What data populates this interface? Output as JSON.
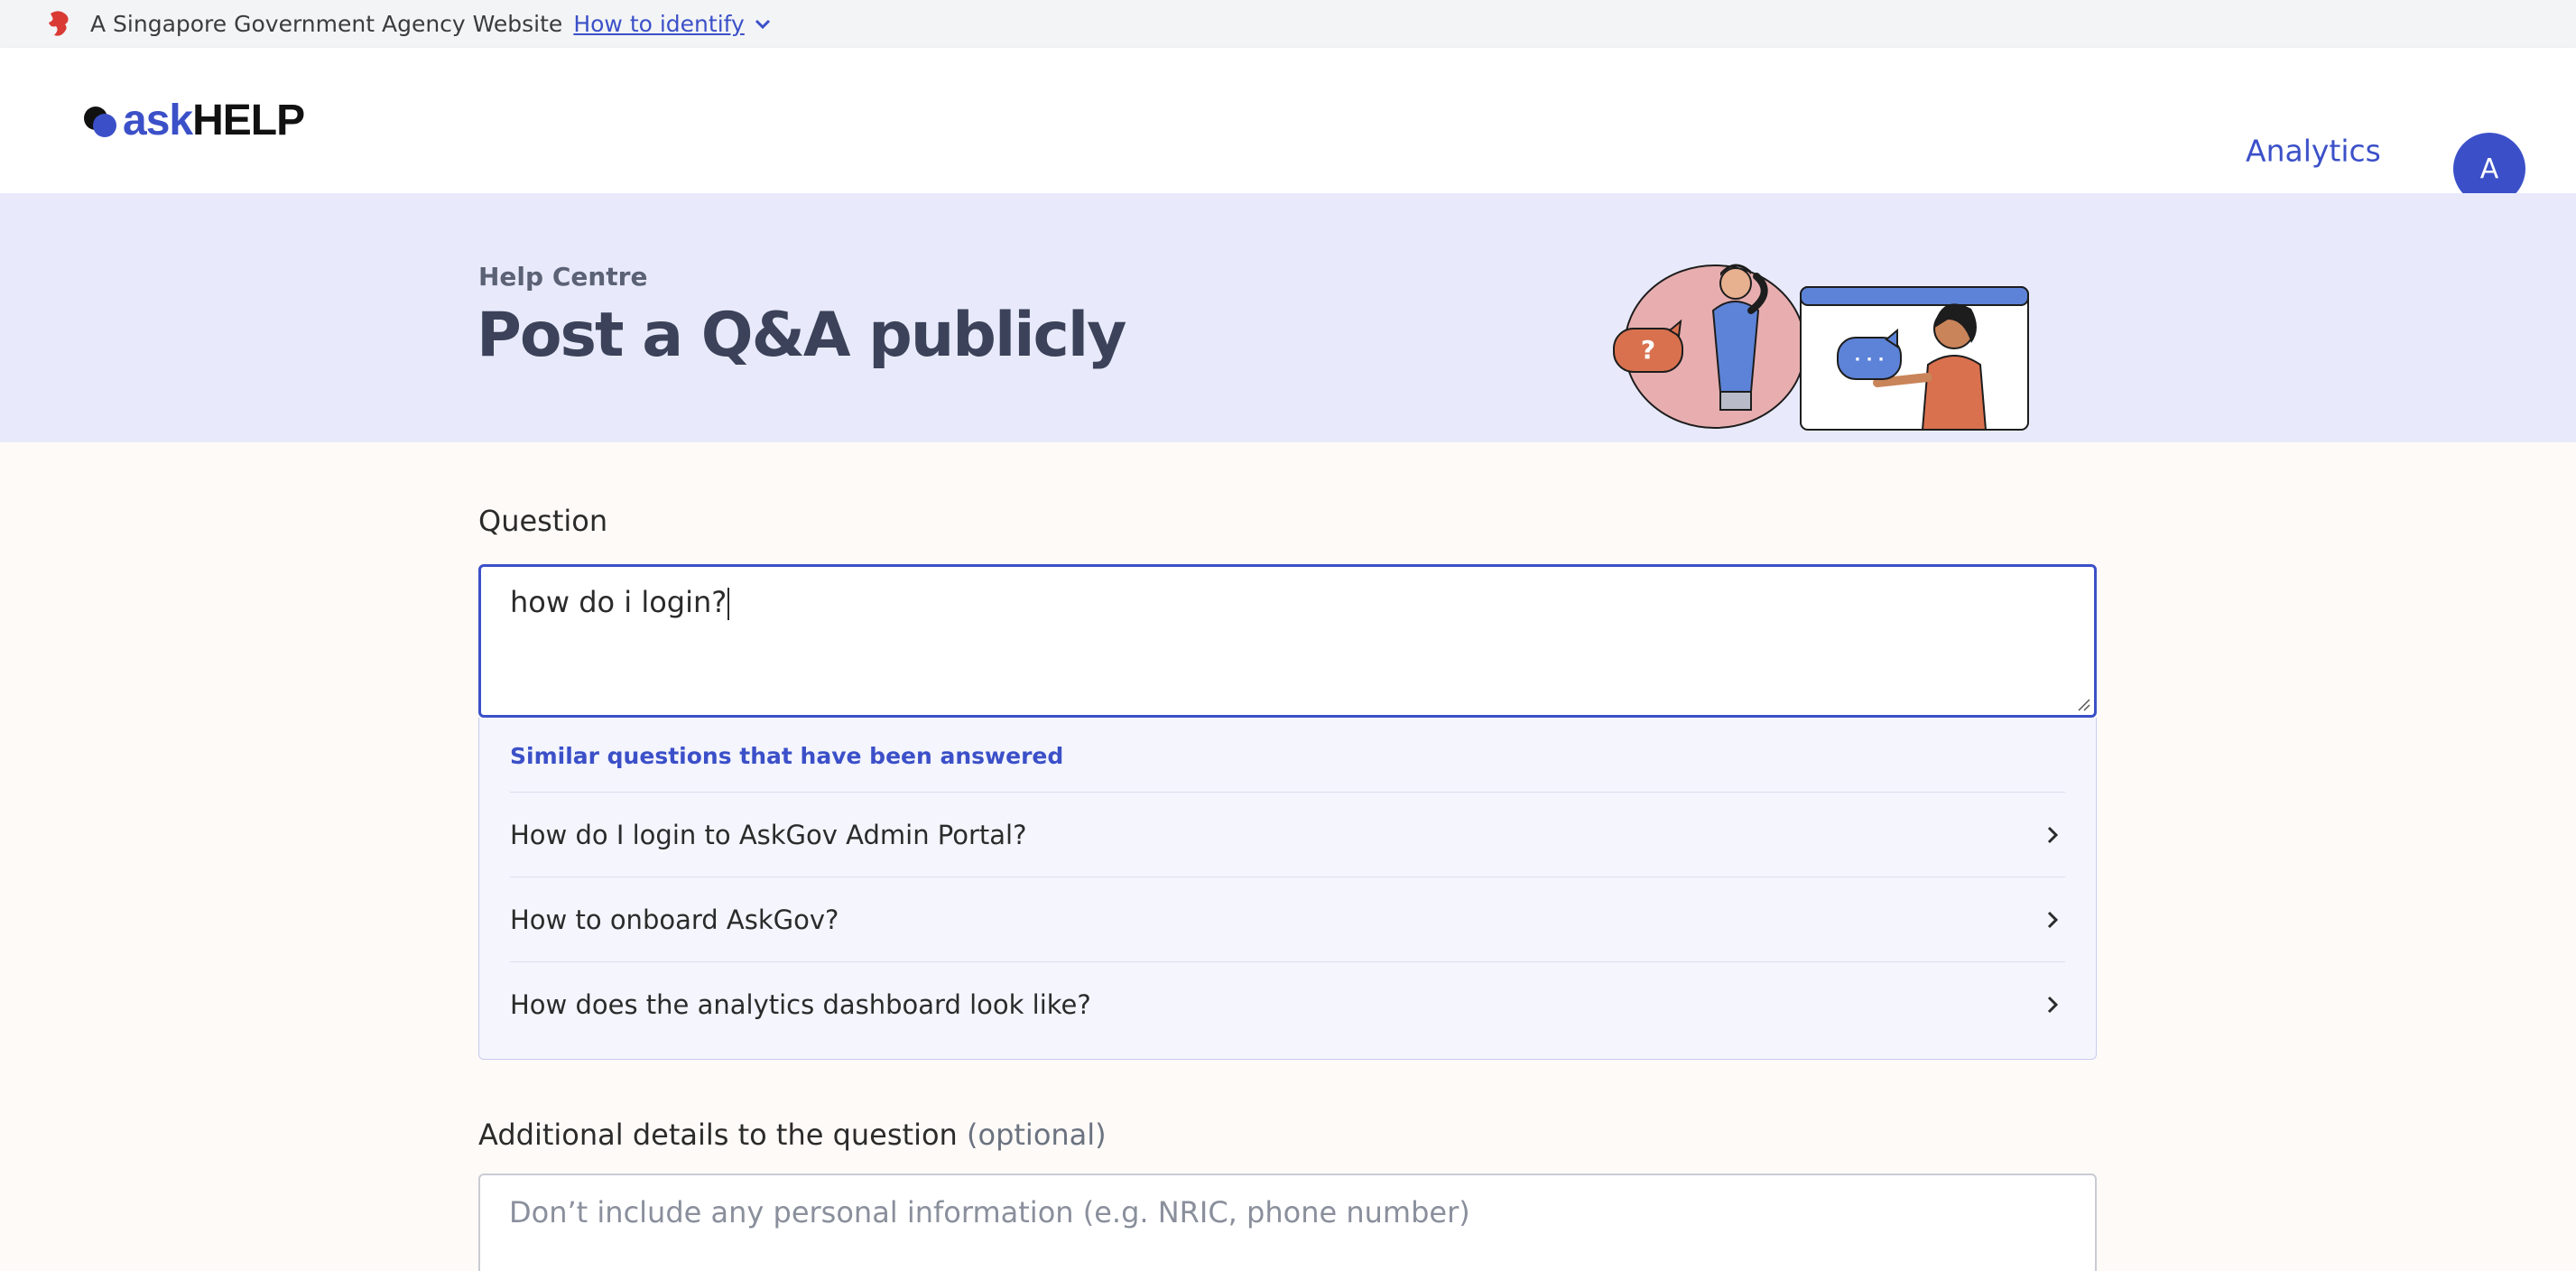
{
  "masthead": {
    "text": "A Singapore Government Agency Website",
    "link": "How to identify"
  },
  "navbar": {
    "logo_ask": "ask",
    "logo_help": "HELP",
    "analytics_label": "Analytics",
    "avatar_initial": "A"
  },
  "hero": {
    "eyebrow": "Help Centre",
    "title": "Post a Q&A publicly",
    "bubble_question": "?",
    "bubble_dots": "· · ·"
  },
  "form": {
    "question_label": "Question",
    "question_value": "how do i login?",
    "similar_heading": "Similar questions that have been answered",
    "similar_questions": [
      "How do I login to AskGov Admin Portal?",
      "How to onboard AskGov?",
      "How does the analytics dashboard look like?"
    ],
    "details_label": "Additional details to the question",
    "details_optional": "(optional)",
    "details_placeholder": "Don’t include any personal information (e.g. NRIC, phone number)"
  },
  "colors": {
    "primary": "#3b50c8",
    "hero_bg": "#e8eafb",
    "page_bg": "#fefaf7"
  }
}
